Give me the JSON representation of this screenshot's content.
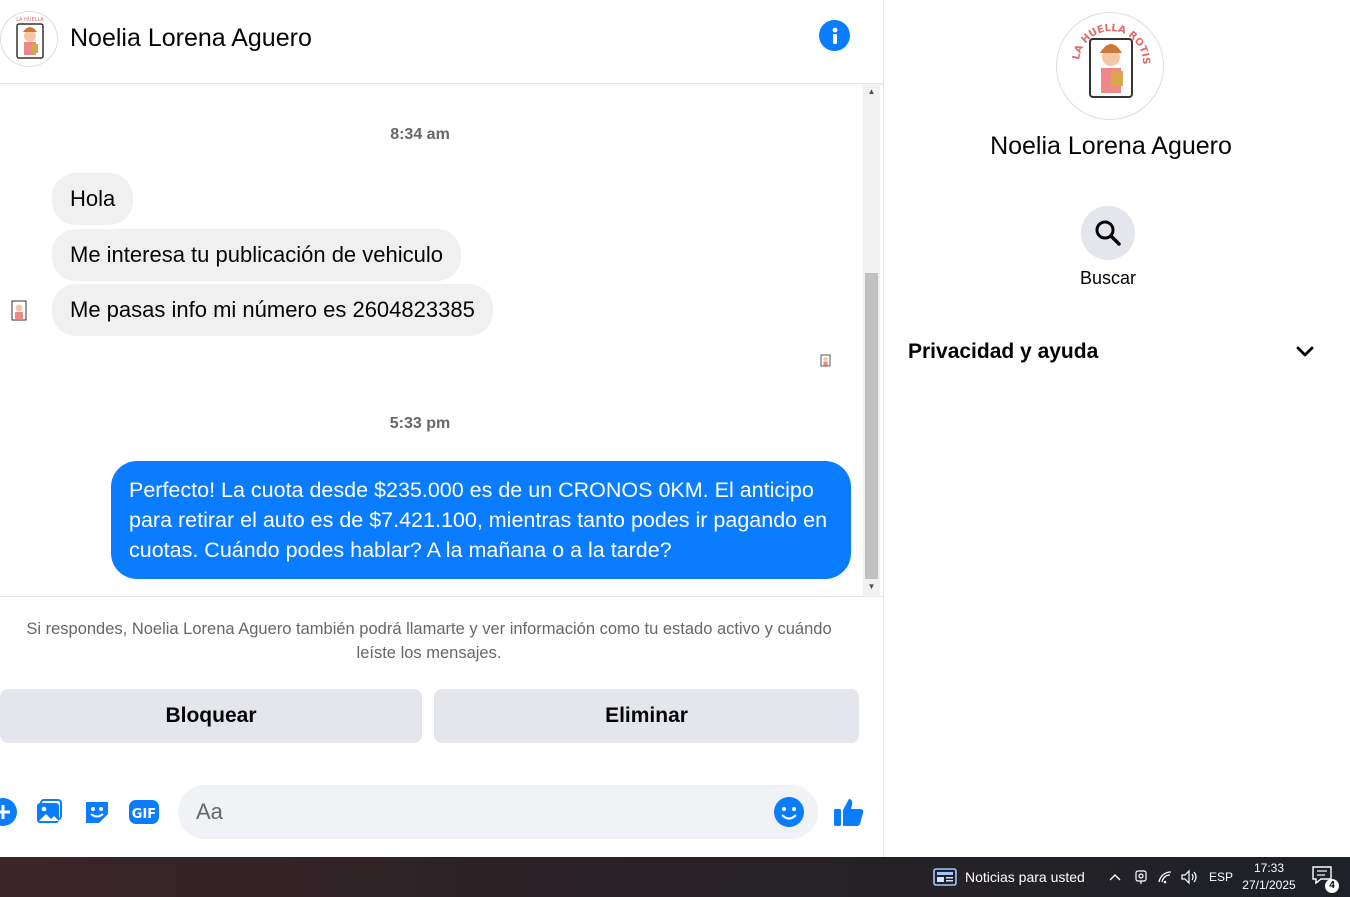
{
  "contact": {
    "name": "Noelia Lorena Aguero",
    "avatar_logo_text": "LA HUELLA ROTISERIA"
  },
  "conversation": {
    "groups": [
      {
        "time": "8:34 am",
        "incoming": [
          "Hola",
          "Me interesa tu publicación de vehiculo",
          "Me pasas info mi número  es 2604823385"
        ]
      },
      {
        "time": "5:33 pm",
        "outgoing": "Perfecto! La cuota desde $235.000 es de un CRONOS 0KM. El anticipo para retirar el auto es de $7.421.100, mientras tanto podes ir pagando en cuotas. Cuándo podes hablar? A la mañana o a la tarde?"
      }
    ]
  },
  "notice": "Si respondes, Noelia Lorena Aguero también podrá llamarte y ver información como tu estado activo y cuándo leíste los mensajes.",
  "actions": {
    "block_label": "Bloquear",
    "delete_label": "Eliminar"
  },
  "composer": {
    "placeholder": "Aa",
    "icons": [
      "plus-icon",
      "image-icon",
      "sticker-icon",
      "gif-icon",
      "emoji-icon",
      "like-icon"
    ],
    "gif_text": "GIF"
  },
  "right_panel": {
    "name": "Noelia Lorena Aguero",
    "search_label": "Buscar",
    "privacy_label": "Privacidad y ayuda"
  },
  "taskbar": {
    "news_label": "Noticias para usted",
    "language": "ESP",
    "time": "17:33",
    "date": "27/1/2025",
    "notification_count": "4"
  },
  "colors": {
    "accent": "#0a7cff",
    "incoming_bubble": "#f0f0f0",
    "button_bg": "#e4e6eb"
  }
}
